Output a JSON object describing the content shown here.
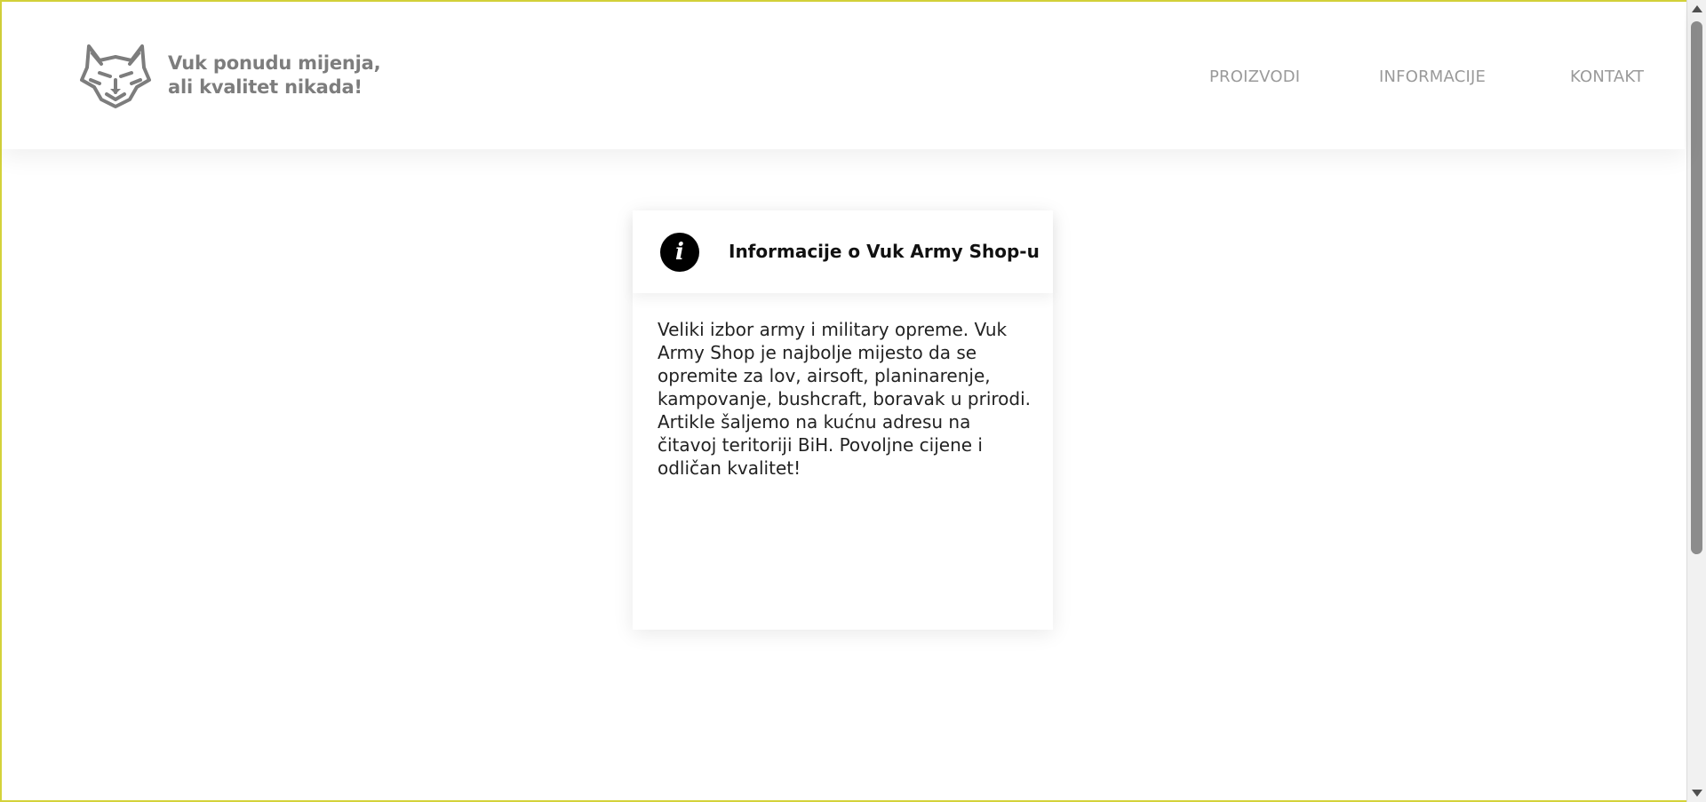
{
  "header": {
    "tagline_line1": "Vuk ponudu mijenja,",
    "tagline_line2": "ali kvalitet nikada!",
    "logo_icon": "wolf-head-icon"
  },
  "nav": {
    "items": [
      {
        "label": "PROIZVODI"
      },
      {
        "label": "INFORMACIJE"
      },
      {
        "label": "KONTAKT"
      }
    ]
  },
  "info_card": {
    "icon": "info-icon",
    "icon_glyph": "i",
    "title": "Informacije o Vuk Army Shop-u",
    "body": "Veliki izbor army i military opreme. Vuk Army Shop je najbolje mijesto da se opremite za lov, airsoft, planinarenje, kampovanje, bushcraft, boravak u prirodi. Artikle šaljemo na kućnu adresu na čitavoj teritoriji BiH. Povoljne cijene i odličan kvalitet!"
  },
  "colors": {
    "text_gray": "#7d7d7d",
    "nav_gray": "#9a9a9a",
    "frame_yellow": "#d4d23a",
    "icon_black": "#000000"
  }
}
